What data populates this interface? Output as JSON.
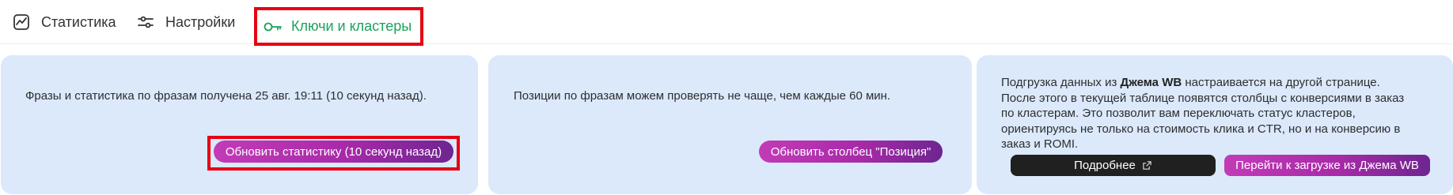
{
  "tabs": [
    {
      "label": "Статистика",
      "icon": "chart-line-icon"
    },
    {
      "label": "Настройки",
      "icon": "sliders-icon"
    },
    {
      "label": "Ключи и кластеры",
      "icon": "key-icon"
    }
  ],
  "cards": {
    "stats": {
      "text": "Фразы и статистика по фразам получена 25 авг. 19:11 (10 секунд назад).",
      "button": "Обновить статистику (10 секунд назад)"
    },
    "positions": {
      "text": "Позиции по фразам можем проверять не чаще, чем каждые 60 мин.",
      "button": "Обновить столбец \"Позиция\""
    },
    "jem": {
      "text_before": "Подгрузка данных из ",
      "text_bold": "Джема WB",
      "text_after": " настраивается на другой странице. После этого в текущей таблице появятся столбцы с конверсиями в заказ по кластерам. Это позволит вам переключать статус кластеров, ориентируясь не только на стоимость клика и CTR, но и на конверсию в заказ и ROMI.",
      "more_button": "Подробнее",
      "go_button": "Перейти к загрузке из Джема WB"
    }
  },
  "colors": {
    "active_tab": "#1aa35a",
    "card_bg": "#dbe9fb",
    "highlight": "#e60012",
    "gradient_start": "#c23bb7",
    "gradient_end": "#6e2590"
  }
}
